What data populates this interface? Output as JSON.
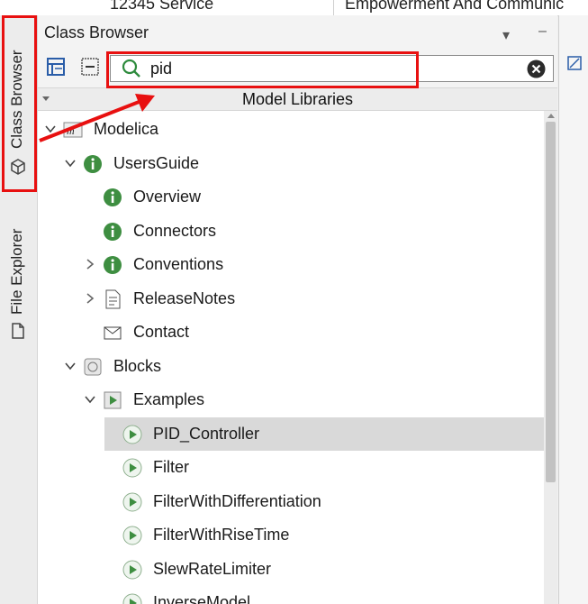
{
  "top_bar": {
    "left_text": "12345 Service",
    "right_text": "Empowerment And Communic"
  },
  "side_tabs": [
    {
      "label": "Class Browser",
      "icon": "cube-icon"
    },
    {
      "label": "File Explorer",
      "icon": "file-icon"
    }
  ],
  "panel": {
    "title": "Class Browser",
    "menu_glyph": "▾",
    "close_glyph": "–"
  },
  "search": {
    "value": "pid",
    "placeholder": "",
    "search_icon": "search-icon",
    "clear_icon": "clear-icon"
  },
  "list_header": "Model Libraries",
  "tree": [
    {
      "label": "Modelica",
      "icon": "modelica-icon",
      "expander": "expanded",
      "indent": 0
    },
    {
      "label": "UsersGuide",
      "icon": "info-icon",
      "expander": "expanded",
      "indent": 1
    },
    {
      "label": "Overview",
      "icon": "info-icon",
      "expander": "none",
      "indent": 2
    },
    {
      "label": "Connectors",
      "icon": "info-icon",
      "expander": "none",
      "indent": 2
    },
    {
      "label": "Conventions",
      "icon": "info-icon",
      "expander": "collapsed",
      "indent": 2
    },
    {
      "label": "ReleaseNotes",
      "icon": "document-icon",
      "expander": "collapsed",
      "indent": 2
    },
    {
      "label": "Contact",
      "icon": "envelope-icon",
      "expander": "none",
      "indent": 2
    },
    {
      "label": "Blocks",
      "icon": "package-icon",
      "expander": "expanded",
      "indent": 1
    },
    {
      "label": "Examples",
      "icon": "play-package-icon",
      "expander": "expanded",
      "indent": 2
    },
    {
      "label": "PID_Controller",
      "icon": "play-icon",
      "expander": "none",
      "indent": 3,
      "selected": true
    },
    {
      "label": "Filter",
      "icon": "play-icon",
      "expander": "none",
      "indent": 3
    },
    {
      "label": "FilterWithDifferentiation",
      "icon": "play-icon",
      "expander": "none",
      "indent": 3
    },
    {
      "label": "FilterWithRiseTime",
      "icon": "play-icon",
      "expander": "none",
      "indent": 3
    },
    {
      "label": "SlewRateLimiter",
      "icon": "play-icon",
      "expander": "none",
      "indent": 3
    },
    {
      "label": "InverseModel",
      "icon": "play-icon",
      "expander": "none",
      "indent": 3
    }
  ],
  "colors": {
    "annotation_red": "#e81010",
    "info_green": "#3e8e41",
    "selection": "#d9d9d9"
  }
}
